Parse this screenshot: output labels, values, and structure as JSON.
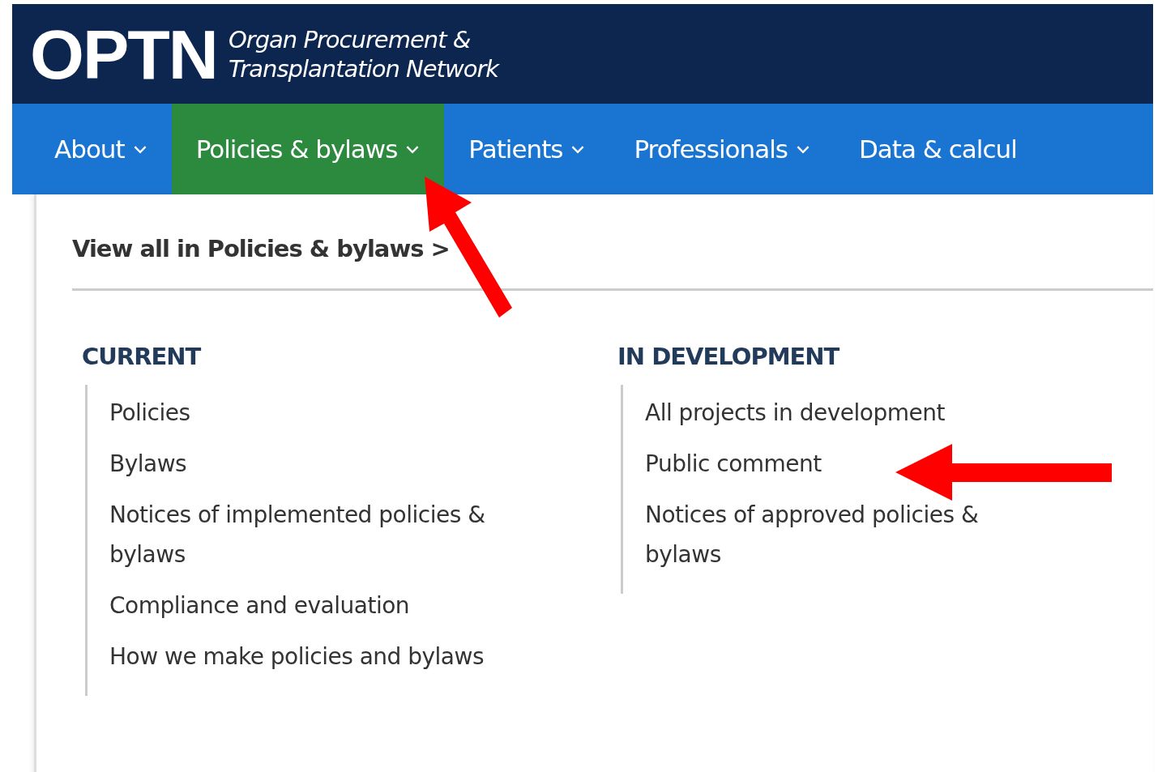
{
  "header": {
    "logo": "OPTN",
    "tagline": [
      "Organ Procurement &",
      "Transplantation Network"
    ]
  },
  "nav": [
    {
      "label": "About",
      "selected": false
    },
    {
      "label": "Policies & bylaws",
      "selected": true
    },
    {
      "label": "Patients",
      "selected": false
    },
    {
      "label": "Professionals",
      "selected": false
    },
    {
      "label": "Data & calcul",
      "selected": false
    }
  ],
  "dropdown": {
    "view_all": "View all in Policies & bylaws >",
    "columns": [
      {
        "heading": "CURRENT",
        "items": [
          "Policies",
          "Bylaws",
          "Notices of implemented policies & bylaws",
          "Compliance and evaluation",
          "How we make policies and bylaws"
        ]
      },
      {
        "heading": "IN DEVELOPMENT",
        "items": [
          "All projects in development",
          "Public comment",
          "Notices of approved policies & bylaws"
        ]
      }
    ]
  }
}
